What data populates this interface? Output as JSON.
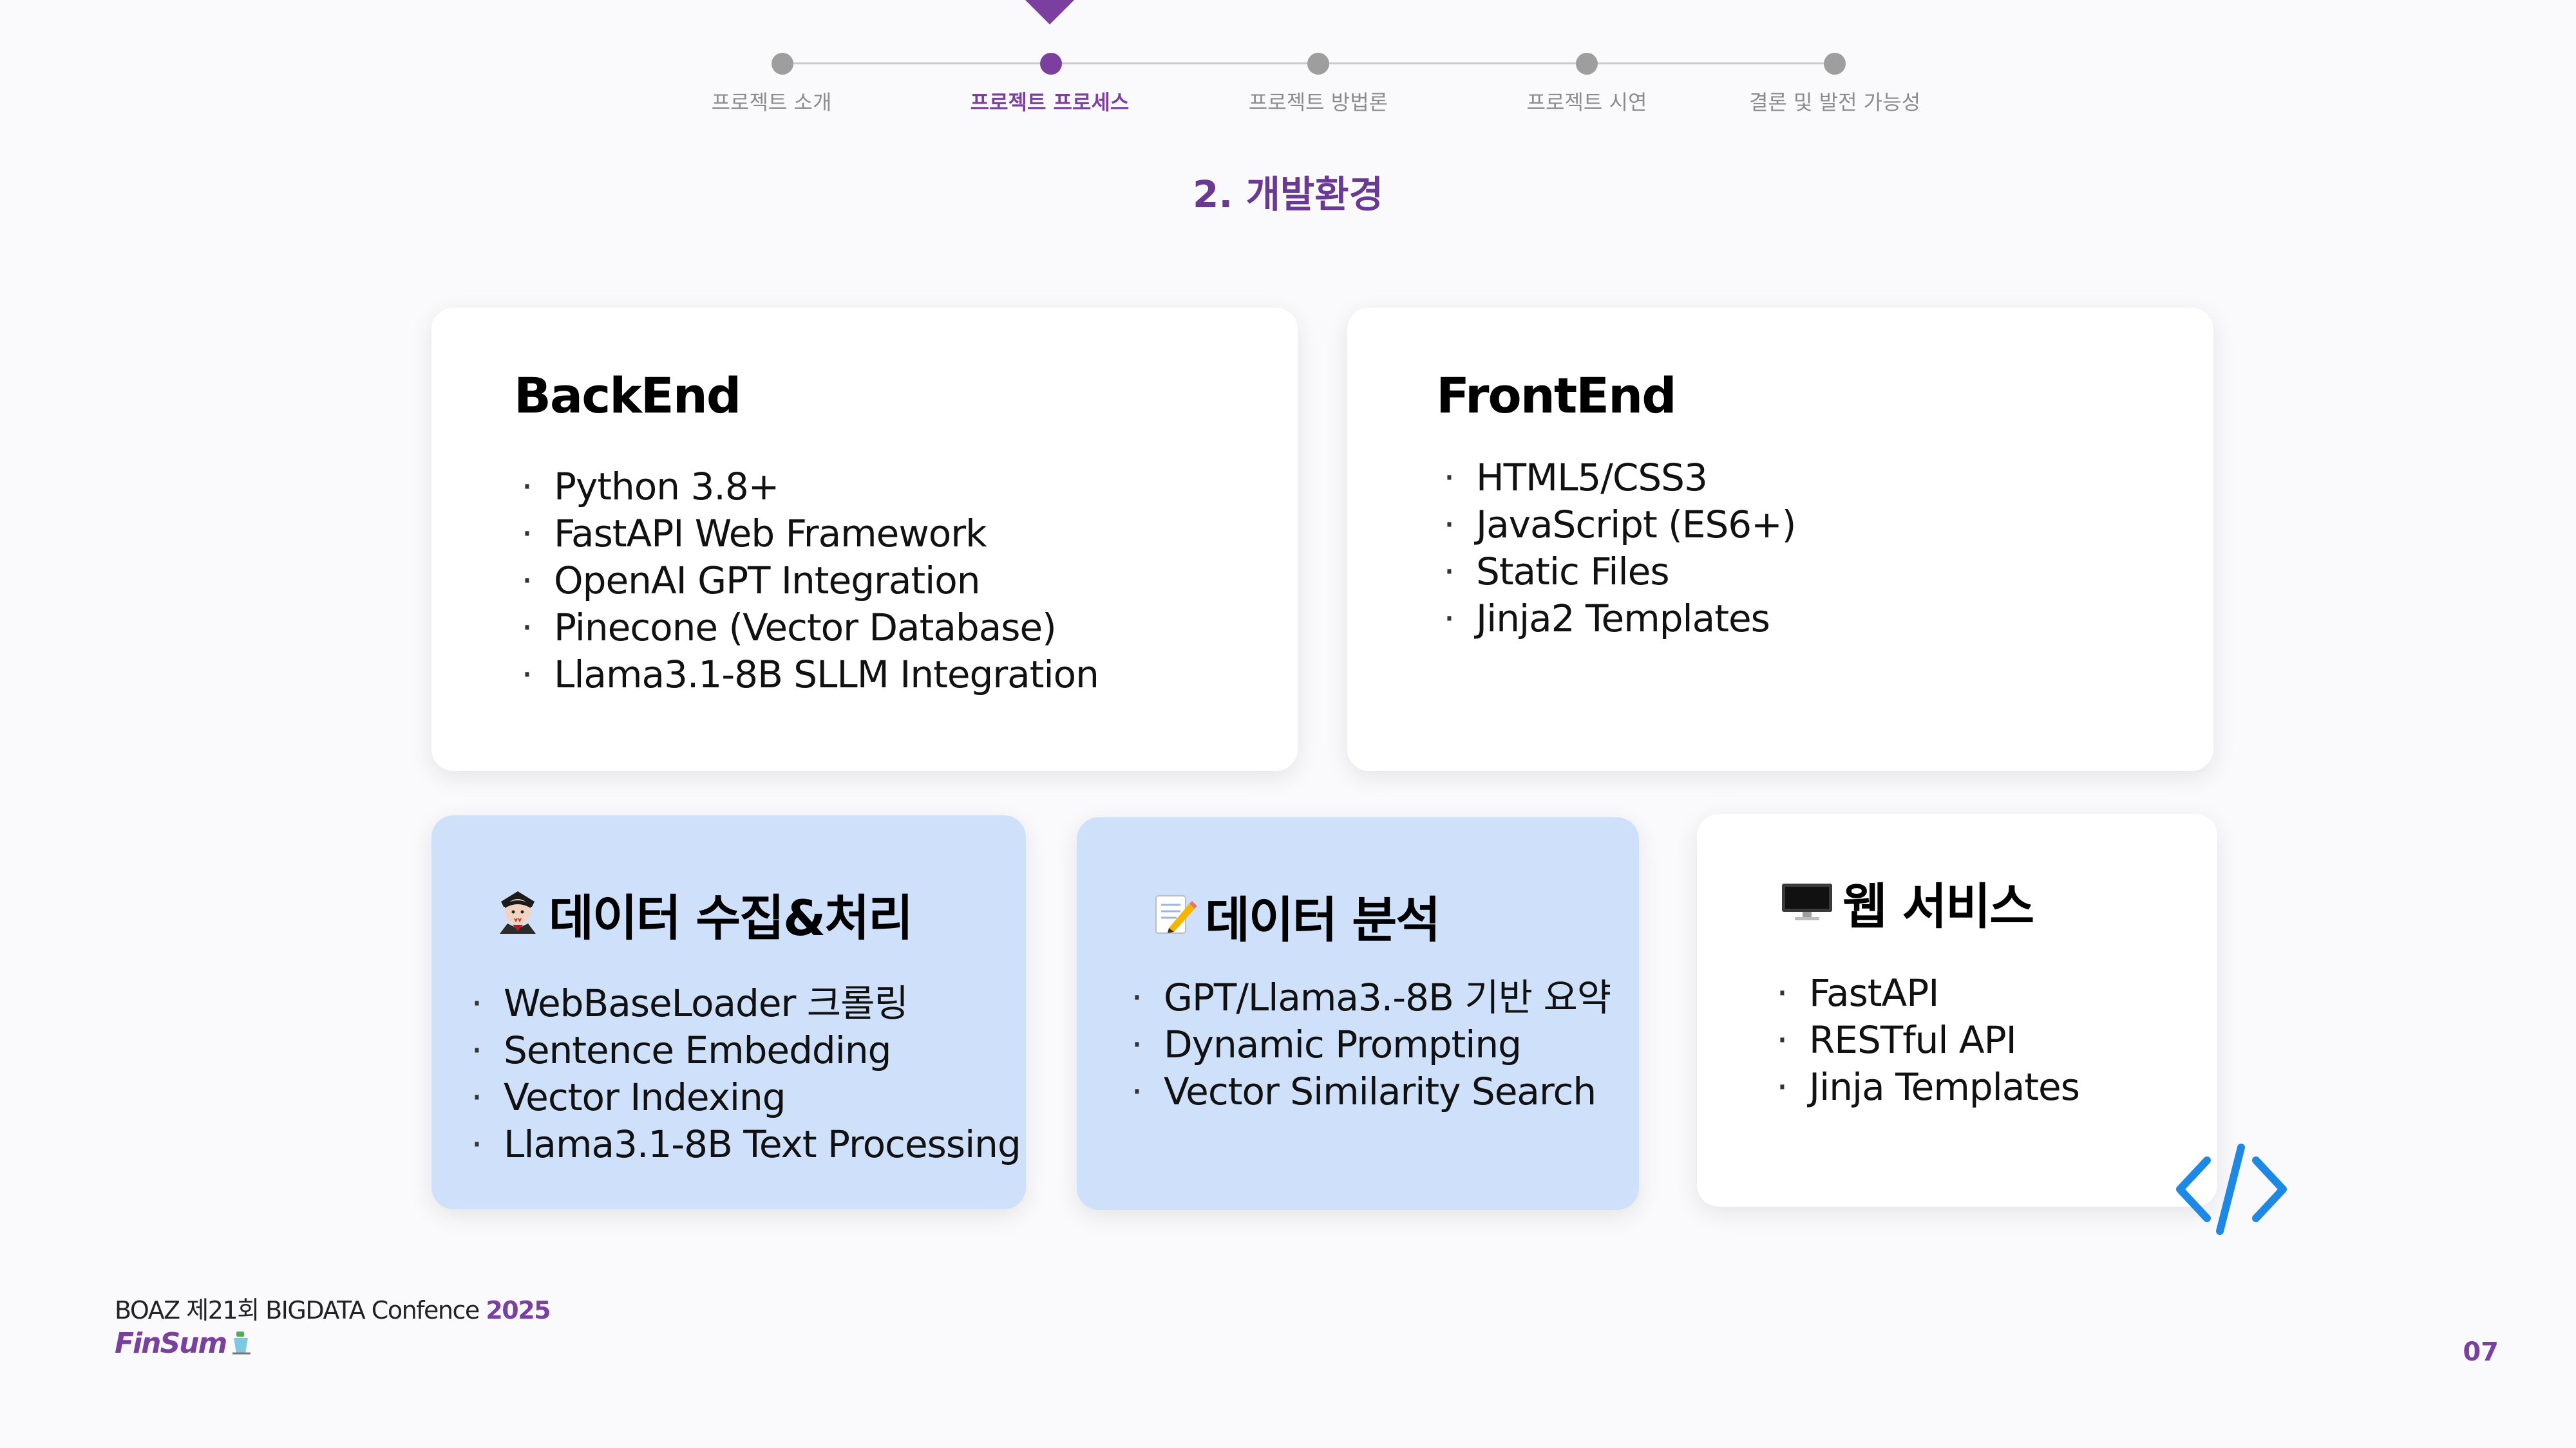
{
  "nav": {
    "steps": [
      {
        "label": "프로젝트 소개",
        "active": false
      },
      {
        "label": "프로젝트 프로세스",
        "active": true
      },
      {
        "label": "프로젝트 방법론",
        "active": false
      },
      {
        "label": "프로젝트 시연",
        "active": false
      },
      {
        "label": "결론 및 발전 가능성",
        "active": false
      }
    ],
    "accent_color": "#7b3fa0"
  },
  "section_title": "2. 개발환경",
  "cards": {
    "backend": {
      "title": "BackEnd",
      "items": [
        "Python 3.8+",
        "FastAPI Web Framework",
        "OpenAI GPT Integration",
        "Pinecone (Vector Database)",
        "Llama3.1-8B SLLM Integration"
      ]
    },
    "frontend": {
      "title": "FrontEnd",
      "items": [
        "HTML5/CSS3",
        "JavaScript (ES6+)",
        "Static Files",
        "Jinja2 Templates"
      ]
    },
    "data_collection": {
      "icon": "vampire-emoji-icon",
      "title": "데이터 수집&처리",
      "items": [
        "WebBaseLoader 크롤링",
        "Sentence Embedding",
        "Vector Indexing",
        "Llama3.1-8B Text Processing"
      ]
    },
    "data_analysis": {
      "icon": "memo-emoji-icon",
      "title": "데이터 분석",
      "items": [
        "GPT/Llama3.-8B 기반 요약",
        "Dynamic Prompting",
        "Vector Similarity Search"
      ]
    },
    "web_service": {
      "icon": "desktop-computer-icon",
      "title": "웹 서비스",
      "items": [
        "FastAPI",
        "RESTful API",
        "Jinja Templates"
      ]
    }
  },
  "bullet_char": "·",
  "card_blue_color": "#cfe0fb",
  "footer": {
    "text": "BOAZ 제21회 BIGDATA Confence ",
    "year": "2025",
    "brand": "FinSum"
  },
  "page_number": "07"
}
